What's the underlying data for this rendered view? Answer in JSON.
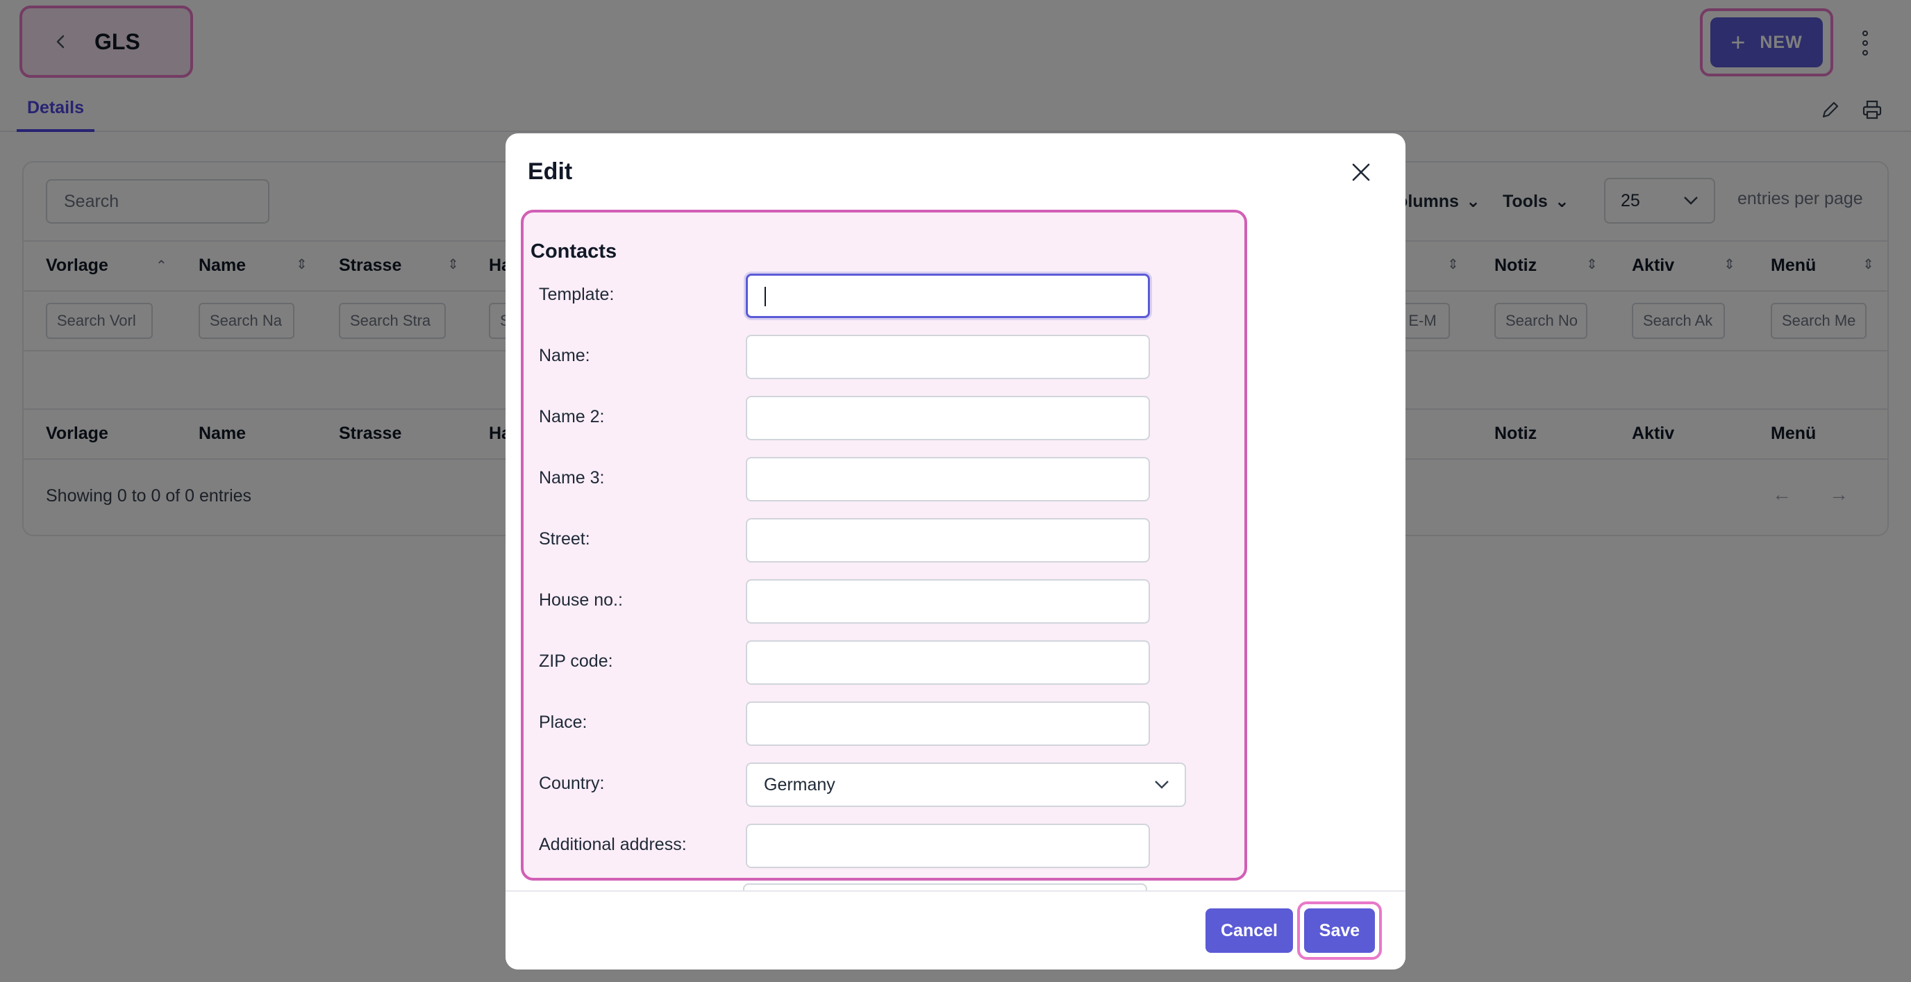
{
  "header": {
    "back_icon": "chevron-left-icon",
    "title": "GLS",
    "new_label": "NEW",
    "new_icon": "plus-icon",
    "more_icon": "kebab-menu-icon"
  },
  "tabs": [
    {
      "label": "Details",
      "active": true
    }
  ],
  "tab_actions": [
    "pencil-icon",
    "printer-icon"
  ],
  "table": {
    "search_placeholder": "Search",
    "columns_label": "Columns",
    "tools_label": "Tools",
    "page_size": "25",
    "per_page_label": "entries per page",
    "columns": [
      "Vorlage",
      "Name",
      "Strasse",
      "Ha",
      "Notiz",
      "Aktiv",
      "Menü"
    ],
    "column_search": [
      "Search Vorl",
      "Search Na",
      "Search Stra",
      "S",
      "h E-M",
      "Search No",
      "Search Ak",
      "Search Me"
    ],
    "showing": "Showing 0 to 0 of 0 entries",
    "prev_icon": "arrow-left-icon",
    "next_icon": "arrow-right-icon"
  },
  "modal": {
    "title": "Edit",
    "close_icon": "close-icon",
    "section_title": "Contacts",
    "fields": [
      {
        "label": "Template:",
        "value": ""
      },
      {
        "label": "Name:",
        "value": ""
      },
      {
        "label": "Name 2:",
        "value": ""
      },
      {
        "label": "Name 3:",
        "value": ""
      },
      {
        "label": "Street:",
        "value": ""
      },
      {
        "label": "House no.:",
        "value": ""
      },
      {
        "label": "ZIP code:",
        "value": ""
      },
      {
        "label": "Place:",
        "value": ""
      },
      {
        "label": "Country:",
        "value": "Germany",
        "type": "select"
      },
      {
        "label": "Additional address:",
        "value": ""
      }
    ],
    "cancel_label": "Cancel",
    "save_label": "Save"
  },
  "colors": {
    "accent": "#5b5bd6",
    "highlight": "#e879c8",
    "overlay": "rgba(0,0,0,0.5)"
  }
}
